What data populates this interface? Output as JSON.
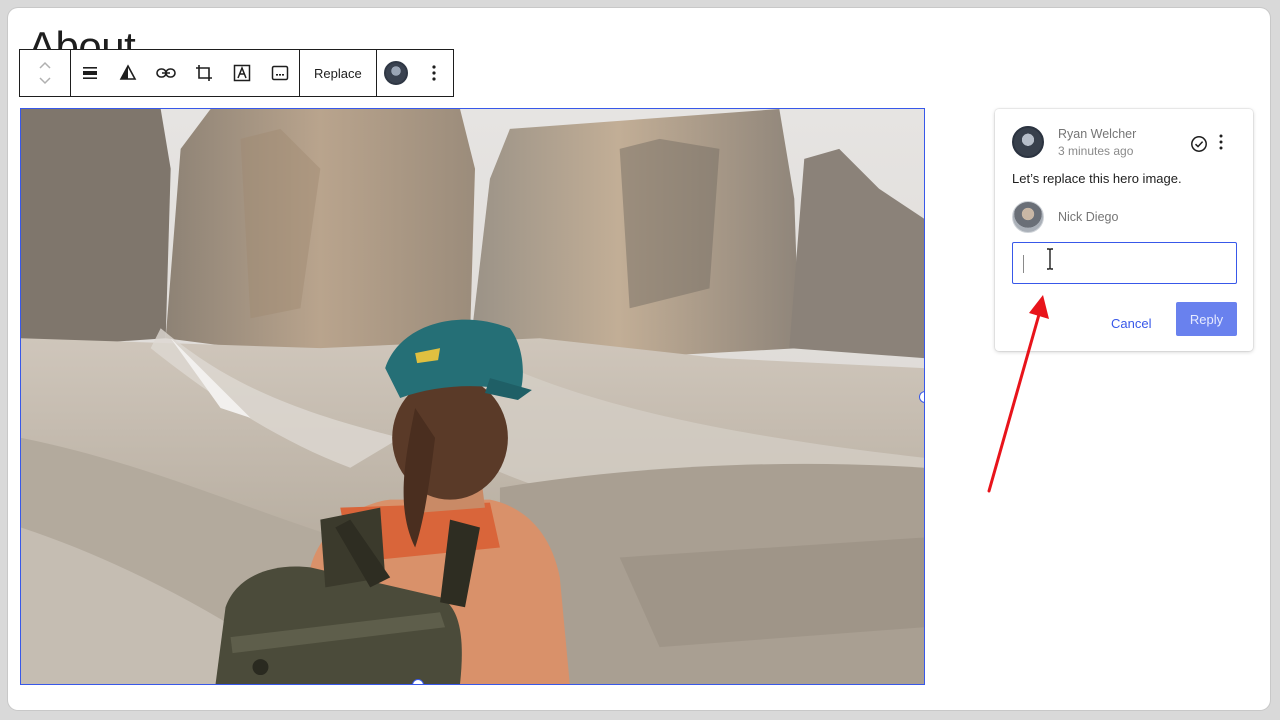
{
  "page": {
    "title": "About"
  },
  "toolbar": {
    "replace_label": "Replace",
    "icons": [
      "move-up-icon",
      "move-down-icon",
      "align-icon",
      "duotone-icon",
      "link-icon",
      "crop-icon",
      "text-overlay-icon",
      "caption-icon",
      "avatar",
      "more-options-icon"
    ]
  },
  "comment": {
    "author": "Ryan Welcher",
    "time": "3 minutes ago",
    "text": "Let’s replace this hero image.",
    "reply_user": "Nick Diego",
    "reply_value": "",
    "cancel_label": "Cancel",
    "reply_label": "Reply"
  },
  "colors": {
    "accent": "#3858e9",
    "annotation_arrow": "#e8141b",
    "text": "#1e1e1e",
    "muted": "#757575"
  }
}
